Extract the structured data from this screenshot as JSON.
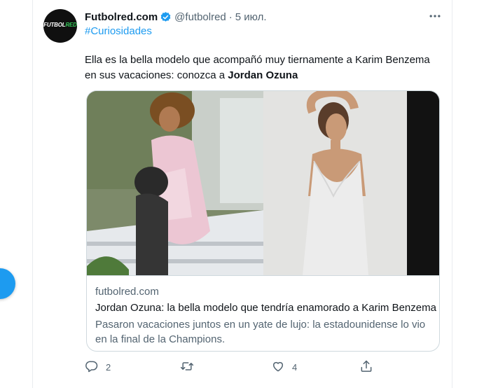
{
  "tweet": {
    "avatar_text_a": "FUTBOL",
    "avatar_text_b": "RED",
    "display_name": "Futbolred.com",
    "handle": "@futbolred",
    "separator": "·",
    "time": "5 июл.",
    "hashtag": "#Curiosidades",
    "text_plain": "Ella es la bella modelo que acompañó muy tiernamente a Karim Benzema en sus vacaciones: conozca a ",
    "text_bold": "Jordan Ozuna",
    "verified_icon": "verified-badge",
    "more_icon": "more-horizontal"
  },
  "card": {
    "domain": "futbolred.com",
    "title": "Jordan Ozuna: la bella modelo que tendría enamorado a Karim Benzema",
    "description": "Pasaron vacaciones juntos en un yate de lujo: la estadounidense lo vio en la final de la Champions."
  },
  "actions": {
    "reply_count": "2",
    "retweet_count": "",
    "like_count": "4",
    "icons": [
      "reply-icon",
      "retweet-icon",
      "like-icon",
      "share-icon"
    ]
  },
  "colors": {
    "accent": "#1d9bf0",
    "text": "#0f1419",
    "secondary": "#536471",
    "border": "#cfd9de"
  }
}
